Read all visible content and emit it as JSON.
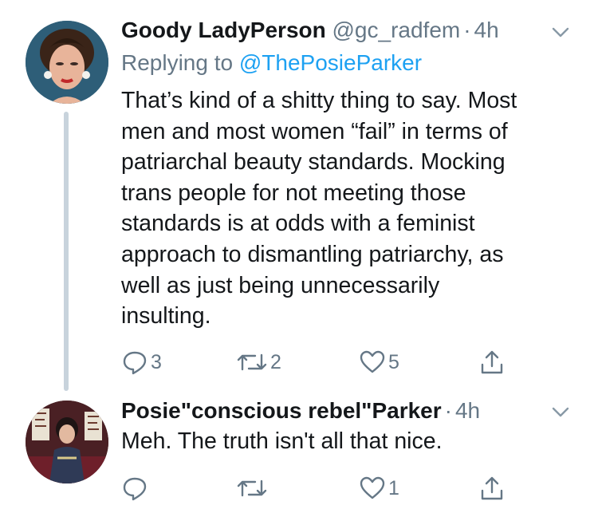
{
  "tweets": [
    {
      "author_name": "Goody LadyPerson",
      "handle": "@gc_radfem",
      "separator": "·",
      "time": "4h",
      "replying_prefix": "Replying to",
      "replying_to": "@ThePosieParker",
      "body_lines": [
        "That’s kind of a shitty thing to say. Most",
        "men and most women “fail” in terms of",
        "patriarchal beauty standards. Mocking",
        "trans people for not meeting those",
        "standards is at odds with a feminist",
        "approach to dismantling patriarchy, as",
        "well as just being unnecessarily",
        "insulting."
      ],
      "reply_count": "3",
      "retweet_count": "2",
      "like_count": "5"
    },
    {
      "author_name": "Posie\"conscious rebel\"Parker",
      "separator": "·",
      "time": "4h",
      "body_lines": [
        "Meh.  The truth isn't all that nice."
      ],
      "reply_count": "",
      "retweet_count": "",
      "like_count": "1"
    }
  ],
  "icons": {
    "reply": "reply-icon",
    "retweet": "retweet-icon",
    "like": "heart-icon",
    "share": "share-icon",
    "more": "chevron-down-icon"
  },
  "colors": {
    "name": "#14171a",
    "secondary": "#657786",
    "link": "#1da1f2",
    "thread_line": "#c8d3dc"
  }
}
